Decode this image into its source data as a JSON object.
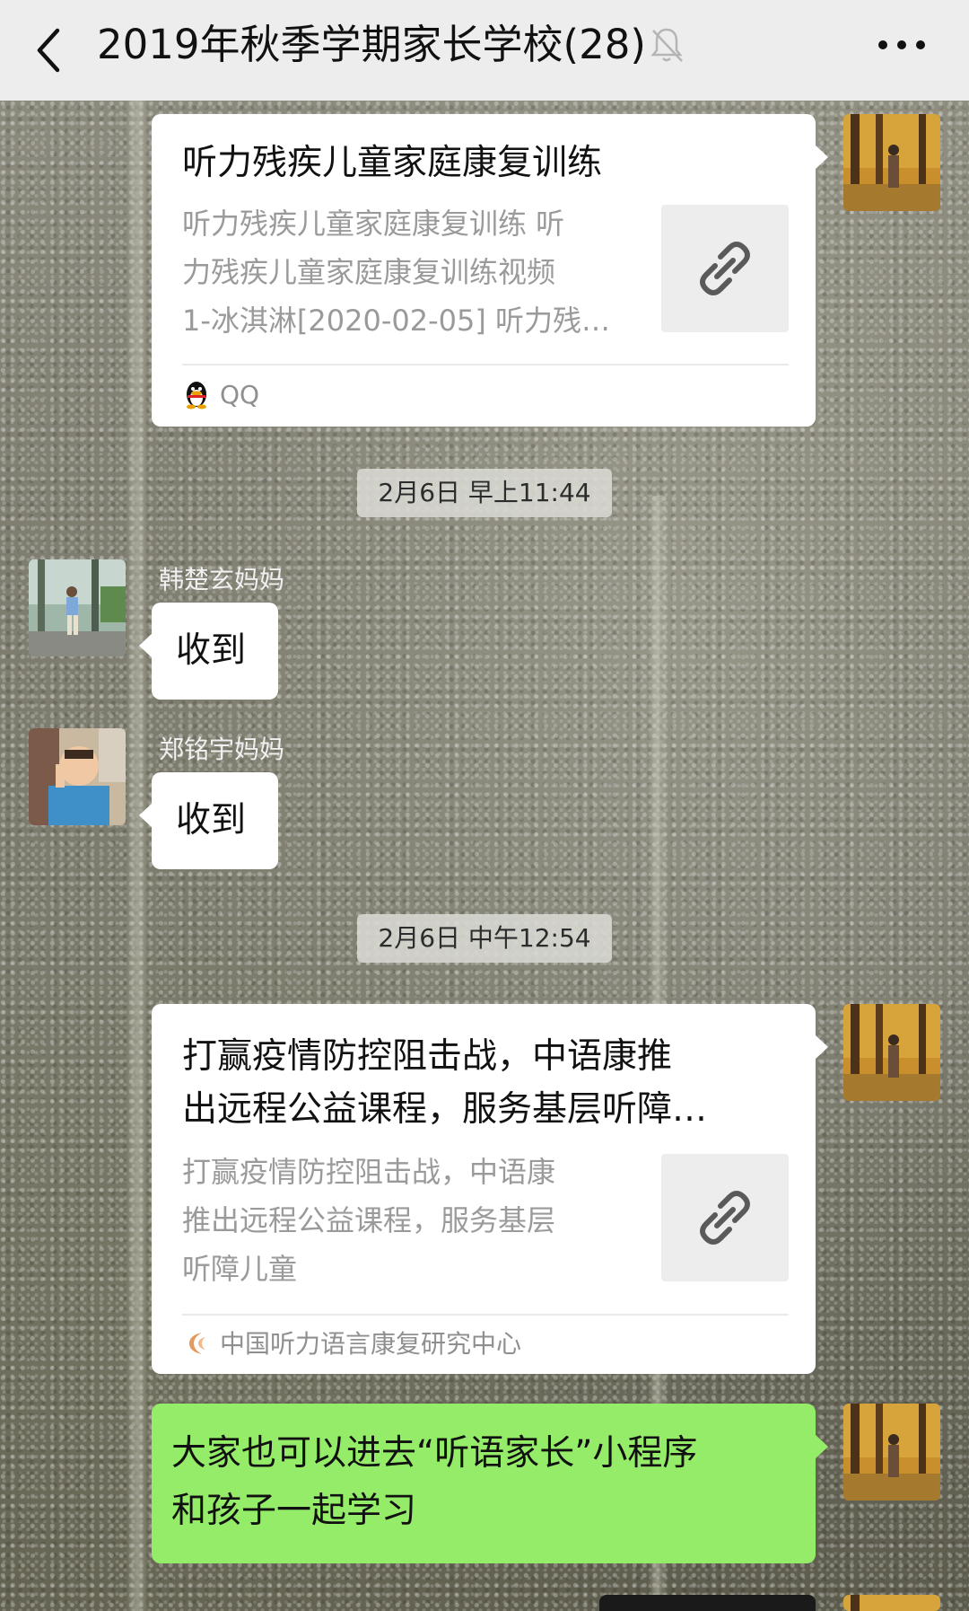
{
  "header": {
    "title": "2019年秋季学期家长学校(28)",
    "back_icon": "back-chevron-icon",
    "mute_icon": "bell-muted-icon",
    "more_icon": "more-dots-icon",
    "background": "#ededed"
  },
  "messages": [
    {
      "type": "link_card",
      "side": "right",
      "title": "听力残疾儿童家庭康复训练",
      "description_lines": [
        "听力残疾儿童家庭康复训练 听",
        "力残疾儿童家庭康复训练视频",
        "1-冰淇淋[2020-02-05] 听力残…"
      ],
      "thumb_icon": "link-icon",
      "source_icon": "qq-penguin-icon",
      "source": "QQ"
    },
    {
      "type": "timestamp",
      "text": "2月6日 早上11:44"
    },
    {
      "type": "text",
      "side": "left",
      "sender": "韩楚玄妈妈",
      "text": "收到"
    },
    {
      "type": "text",
      "side": "left",
      "sender": "郑铭宇妈妈",
      "text": "收到"
    },
    {
      "type": "timestamp",
      "text": "2月6日 中午12:54"
    },
    {
      "type": "link_card",
      "side": "right",
      "title_lines": [
        "打赢疫情防控阻击战，中语康推",
        "出远程公益课程，服务基层听障…"
      ],
      "description_lines": [
        "打赢疫情防控阻击战，中语康",
        "推出远程公益课程，服务基层",
        "听障儿童"
      ],
      "thumb_icon": "link-icon",
      "source_icon": "crescent-logo-icon",
      "source": "中国听力语言康复研究中心"
    },
    {
      "type": "text",
      "side": "right",
      "text_lines": [
        "大家也可以进去“听语家长”小程序",
        "和孩子一起学习"
      ],
      "bubble_color": "#95ec69"
    }
  ]
}
